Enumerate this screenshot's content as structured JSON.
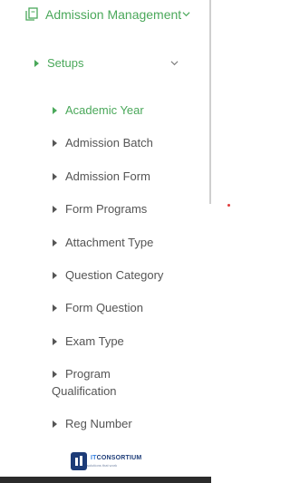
{
  "sidebar": {
    "module": {
      "label": "Admission Management"
    },
    "submenu": {
      "label": "Setups"
    },
    "items": [
      {
        "label": "Academic Year",
        "active": true
      },
      {
        "label": "Admission Batch"
      },
      {
        "label": "Admission Form"
      },
      {
        "label": "Form Programs"
      },
      {
        "label": "Attachment Type"
      },
      {
        "label": "Question Category"
      },
      {
        "label": "Form Question"
      },
      {
        "label": "Exam Type"
      },
      {
        "line1": "Program",
        "line2": "Qualification"
      },
      {
        "label": "Reg Number"
      }
    ]
  },
  "branding": {
    "logo_it": "IT",
    "logo_rest": "CONSORTIUM",
    "tagline": "solutions that work"
  },
  "colors": {
    "accent": "#4aa85a",
    "text": "#555555",
    "brand": "#1d3c78"
  }
}
